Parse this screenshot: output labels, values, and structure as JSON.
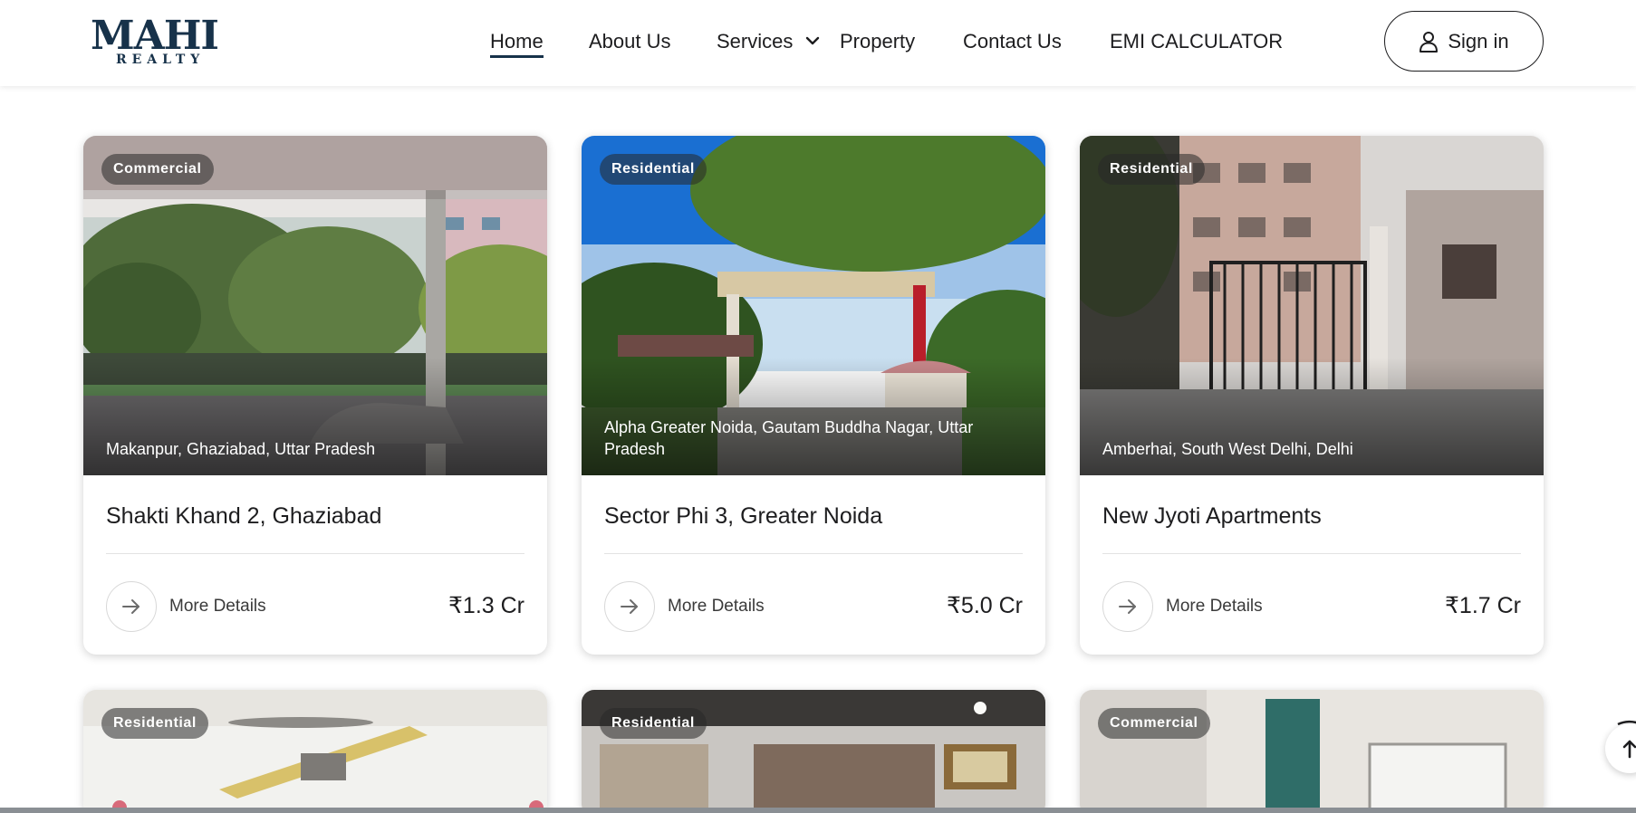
{
  "header": {
    "logo_top": "MAHI",
    "logo_bottom": "REALTY",
    "nav": [
      {
        "label": "Home",
        "active": true
      },
      {
        "label": "About Us"
      },
      {
        "label": "Services"
      },
      {
        "label": "Property"
      },
      {
        "label": "Contact Us"
      },
      {
        "label": "EMI CALCULATOR"
      }
    ],
    "signin_label": "Sign in"
  },
  "cards": [
    {
      "badge": "Commercial",
      "location": "Makanpur, Ghaziabad, Uttar Pradesh",
      "title": "Shakti Khand 2, Ghaziabad",
      "more": "More Details",
      "price": "₹1.3 Cr"
    },
    {
      "badge": "Residential",
      "location": "Alpha Greater Noida, Gautam Buddha Nagar, Uttar Pradesh",
      "title": "Sector Phi 3, Greater Noida",
      "more": "More Details",
      "price": "₹5.0 Cr"
    },
    {
      "badge": "Residential",
      "location": "Amberhai, South West Delhi, Delhi",
      "title": "New Jyoti Apartments",
      "more": "More Details",
      "price": "₹1.7 Cr"
    },
    {
      "badge": "Residential"
    },
    {
      "badge": "Residential"
    },
    {
      "badge": "Commercial"
    }
  ],
  "icons": {
    "user": "user-icon",
    "chevron": "chevron-down-icon",
    "arrow": "arrow-right-icon",
    "up": "arrow-up-icon"
  },
  "colors": {
    "brand": "#17324a",
    "text": "#1d1d1f"
  }
}
